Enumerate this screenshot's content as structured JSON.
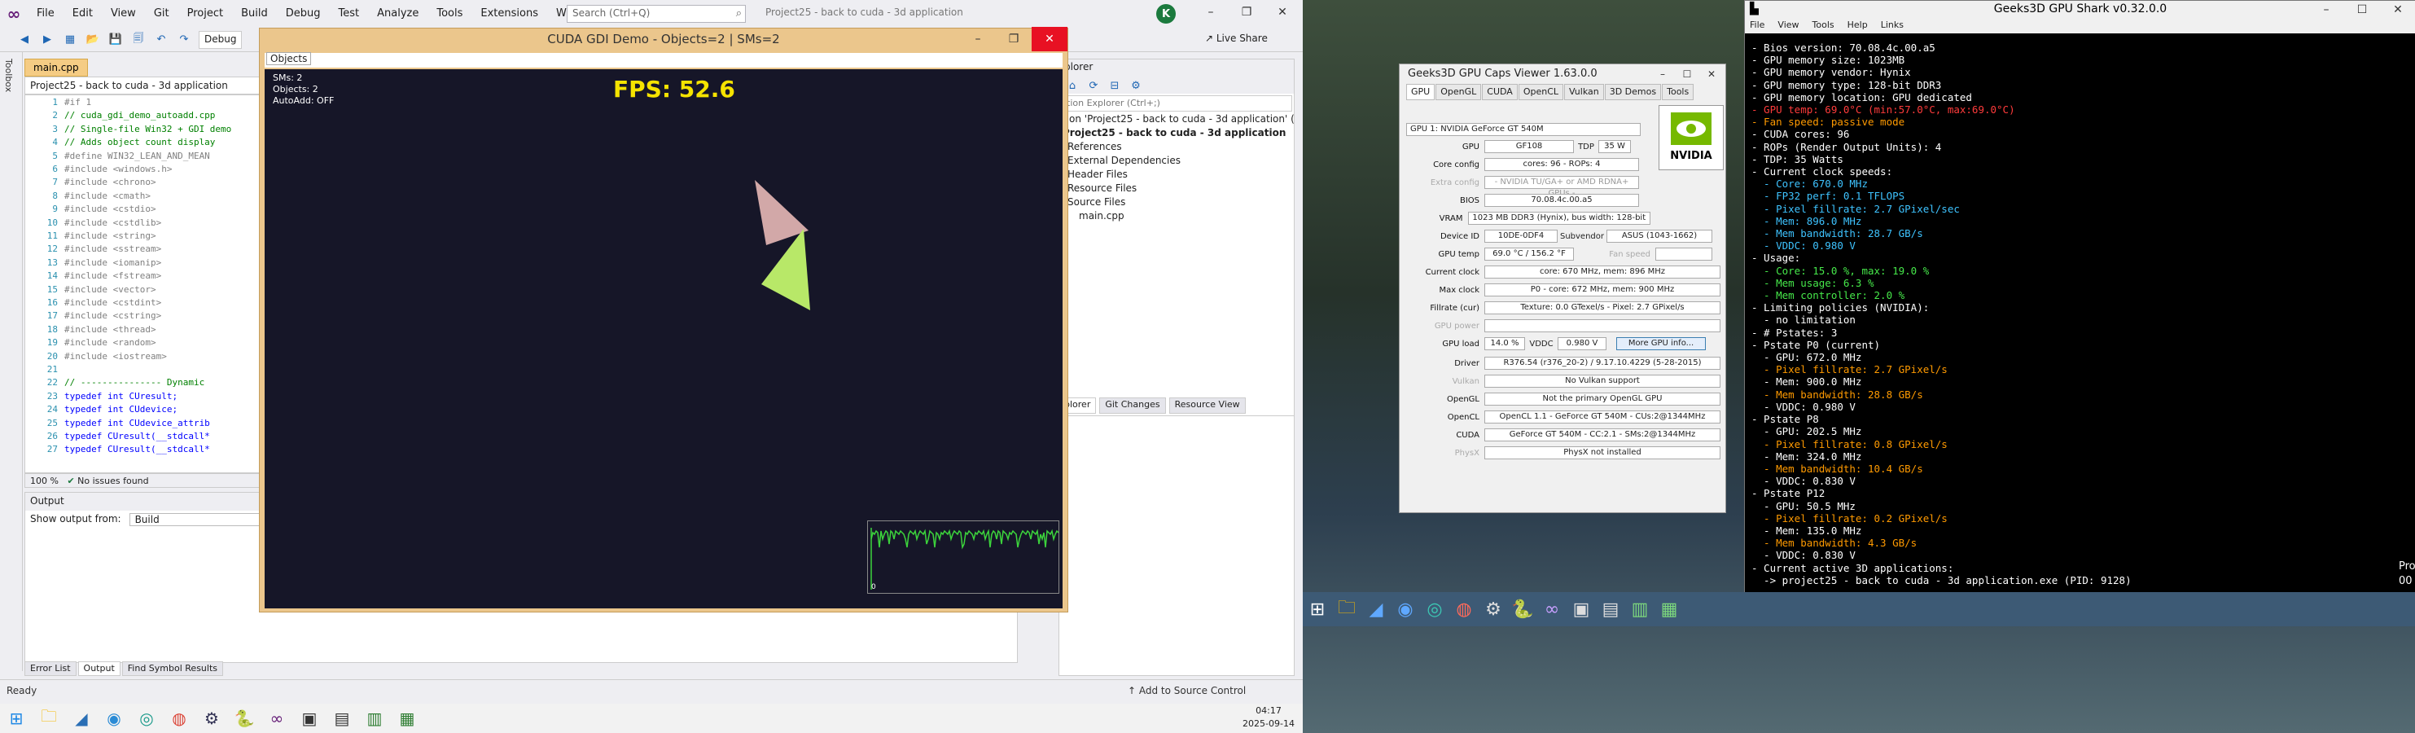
{
  "vs": {
    "menu": [
      "File",
      "Edit",
      "View",
      "Git",
      "Project",
      "Build",
      "Debug",
      "Test",
      "Analyze",
      "Tools",
      "Extensions",
      "Window",
      "Help"
    ],
    "search_placeholder": "Search (Ctrl+Q)",
    "project_title": "Project25 - back to cuda - 3d application",
    "avatar_letter": "K",
    "live_share": "Live Share",
    "debug_combo": "Debug",
    "toolbox_label": "Toolbox",
    "doc_tab": "main.cpp",
    "nav_project": "Project25 - back to cuda - 3d application",
    "code_lines": [
      {
        "n": "1",
        "t": "#if 1",
        "c": "pre"
      },
      {
        "n": "2",
        "t": "// cuda_gdi_demo_autoadd.cpp",
        "c": "comment"
      },
      {
        "n": "3",
        "t": "// Single-file Win32 + GDI demo",
        "c": "comment"
      },
      {
        "n": "4",
        "t": "// Adds object count display",
        "c": "comment"
      },
      {
        "n": "5",
        "t": "#define WIN32_LEAN_AND_MEAN",
        "c": "pre"
      },
      {
        "n": "6",
        "t": "#include <windows.h>",
        "c": "pre"
      },
      {
        "n": "7",
        "t": "#include <chrono>",
        "c": "pre"
      },
      {
        "n": "8",
        "t": "#include <cmath>",
        "c": "pre"
      },
      {
        "n": "9",
        "t": "#include <cstdio>",
        "c": "pre"
      },
      {
        "n": "10",
        "t": "#include <cstdlib>",
        "c": "pre"
      },
      {
        "n": "11",
        "t": "#include <string>",
        "c": "pre"
      },
      {
        "n": "12",
        "t": "#include <sstream>",
        "c": "pre"
      },
      {
        "n": "13",
        "t": "#include <iomanip>",
        "c": "pre"
      },
      {
        "n": "14",
        "t": "#include <fstream>",
        "c": "pre"
      },
      {
        "n": "15",
        "t": "#include <vector>",
        "c": "pre"
      },
      {
        "n": "16",
        "t": "#include <cstdint>",
        "c": "pre"
      },
      {
        "n": "17",
        "t": "#include <cstring>",
        "c": "pre"
      },
      {
        "n": "18",
        "t": "#include <thread>",
        "c": "pre"
      },
      {
        "n": "19",
        "t": "#include <random>",
        "c": "pre"
      },
      {
        "n": "20",
        "t": "#include <iostream>",
        "c": "pre"
      },
      {
        "n": "21",
        "t": "",
        "c": "pre"
      },
      {
        "n": "22",
        "t": "// --------------- Dynamic",
        "c": "comment"
      },
      {
        "n": "23",
        "t": "typedef int CUresult;",
        "c": "typ"
      },
      {
        "n": "24",
        "t": "typedef int CUdevice;",
        "c": "typ"
      },
      {
        "n": "25",
        "t": "typedef int CUdevice_attrib",
        "c": "typ"
      },
      {
        "n": "26",
        "t": "typedef CUresult(__stdcall*",
        "c": "typ"
      },
      {
        "n": "27",
        "t": "typedef CUresult(__stdcall*",
        "c": "typ"
      }
    ],
    "zoom": "100 %",
    "issues": "No issues found",
    "output_title": "Output",
    "output_from_label": "Show output from:",
    "output_from_value": "Build",
    "bottom_tabs": [
      "Error List",
      "Output",
      "Find Symbol Results"
    ],
    "status_ready": "Ready",
    "add_source_control": "Add to Source Control",
    "solution": {
      "title": "plorer",
      "search": "tion Explorer (Ctrl+;)",
      "items": [
        "tion 'Project25 - back to cuda - 3d application' (1 of 1 p",
        "Project25 - back to cuda - 3d application",
        "References",
        "External Dependencies",
        "Header Files",
        "Resource Files",
        "Source Files",
        "main.cpp"
      ],
      "bottom_tabs": [
        "plorer",
        "Git Changes",
        "Resource View"
      ]
    }
  },
  "cuda": {
    "title": "CUDA GDI Demo - Objects=2 | SMs=2",
    "menu": "Objects",
    "overlay": [
      "SMs: 2",
      "Objects: 2",
      "AutoAdd: OFF"
    ],
    "fps": "FPS: 52.6",
    "graph_zero": "0",
    "graph_color": "#3cd43c"
  },
  "left_taskbar": {
    "time": "04:17",
    "date": "2025-09-14"
  },
  "gcv": {
    "title": "Geeks3D GPU Caps Viewer 1.63.0.0",
    "tabs": [
      "GPU",
      "OpenGL",
      "CUDA",
      "OpenCL",
      "Vulkan",
      "3D Demos",
      "Tools"
    ],
    "gpu_select": "GPU 1: NVIDIA GeForce GT 540M",
    "gpu": "GF108",
    "tdp_label": "TDP",
    "tdp": "35 W",
    "core_config": "cores: 96 - ROPs: 4",
    "extra_config": "- NVIDIA TU/GA+ or AMD RDNA+ GPUs -",
    "bios": "70.08.4c.00.a5",
    "vram": "1023 MB DDR3 (Hynix), bus width: 128-bit",
    "device_id": "10DE-0DF4",
    "subvendor_label": "Subvendor",
    "subvendor": "ASUS (1043-1662)",
    "gpu_temp": "69.0 °C / 156.2 °F",
    "fan_speed_label": "Fan speed",
    "current_clock": "core: 670 MHz, mem: 896 MHz",
    "max_clock": "P0 - core: 672 MHz, mem: 900 MHz",
    "fillrate": "Texture: 0.0 GTexel/s - Pixel: 2.7 GPixel/s",
    "gpu_load": "14.0 %",
    "vddc_label": "VDDC",
    "vddc": "0.980 V",
    "more_info": "More GPU info...",
    "driver": "R376.54 (r376_20-2) / 9.17.10.4229 (5-28-2015)",
    "vulkan": "No Vulkan support",
    "opengl": "Not the primary OpenGL GPU",
    "opencl": "OpenCL 1.1 - GeForce GT 540M - CUs:2@1344MHz",
    "cuda": "GeForce GT 540M - CC:2.1 - SMs:2@1344MHz",
    "physx": "PhysX not installed",
    "labels": {
      "gpu": "GPU",
      "core_config": "Core config",
      "extra_config": "Extra config",
      "bios": "BIOS",
      "vram": "VRAM",
      "device_id": "Device ID",
      "gpu_temp": "GPU temp",
      "current_clock": "Current clock",
      "max_clock": "Max clock",
      "fillrate": "Fillrate (cur)",
      "gpu_power": "GPU power",
      "gpu_load": "GPU load",
      "driver": "Driver",
      "vulkan": "Vulkan",
      "opengl": "OpenGL",
      "opencl": "OpenCL",
      "cuda": "CUDA",
      "physx": "PhysX"
    },
    "logo_text": "NVIDIA"
  },
  "shark": {
    "title": "Geeks3D GPU Shark v0.32.0.0",
    "menu": [
      "File",
      "View",
      "Tools",
      "Help",
      "Links"
    ],
    "lines": [
      {
        "t": "- Bios version: 70.08.4c.00.a5",
        "c": "#ffffff"
      },
      {
        "t": "- GPU memory size: 1023MB",
        "c": "#ffffff"
      },
      {
        "t": "- GPU memory vendor: Hynix",
        "c": "#ffffff"
      },
      {
        "t": "- GPU memory type: 128-bit DDR3",
        "c": "#ffffff"
      },
      {
        "t": "- GPU memory location: GPU dedicated",
        "c": "#ffffff"
      },
      {
        "t": "- GPU temp: 69.0°C (min:57.0°C, max:69.0°C)",
        "c": "#ff3b3b"
      },
      {
        "t": "- Fan speed: passive mode",
        "c": "#ff9a00"
      },
      {
        "t": "- CUDA cores: 96",
        "c": "#ffffff"
      },
      {
        "t": "- ROPs (Render Output Units): 4",
        "c": "#ffffff"
      },
      {
        "t": "- TDP: 35 Watts",
        "c": "#ffffff"
      },
      {
        "t": "- Current clock speeds:",
        "c": "#ffffff"
      },
      {
        "t": "  - Core: 670.0 MHz",
        "c": "#3ec3ff"
      },
      {
        "t": "  - FP32 perf: 0.1 TFLOPS",
        "c": "#3ec3ff"
      },
      {
        "t": "  - Pixel fillrate: 2.7 GPixel/sec",
        "c": "#3ec3ff"
      },
      {
        "t": "  - Mem: 896.0 MHz",
        "c": "#3ec3ff"
      },
      {
        "t": "  - Mem bandwidth: 28.7 GB/s",
        "c": "#3ec3ff"
      },
      {
        "t": "  - VDDC: 0.980 V",
        "c": "#3ec3ff"
      },
      {
        "t": "- Usage:",
        "c": "#ffffff"
      },
      {
        "t": "  - Core: 15.0 %, max: 19.0 %",
        "c": "#46e84a"
      },
      {
        "t": "  - Mem usage: 6.3 %",
        "c": "#46e84a"
      },
      {
        "t": "  - Mem controller: 2.0 %",
        "c": "#46e84a"
      },
      {
        "t": "- Limiting policies (NVIDIA):",
        "c": "#ffffff"
      },
      {
        "t": "  - no limitation",
        "c": "#ffffff"
      },
      {
        "t": "- # Pstates: 3",
        "c": "#ffffff"
      },
      {
        "t": "- Pstate P0 (current)",
        "c": "#ffffff"
      },
      {
        "t": "  - GPU: 672.0 MHz",
        "c": "#ffffff"
      },
      {
        "t": "  - Pixel fillrate: 2.7 GPixel/s",
        "c": "#ff9a00"
      },
      {
        "t": "  - Mem: 900.0 MHz",
        "c": "#ffffff"
      },
      {
        "t": "  - Mem bandwidth: 28.8 GB/s",
        "c": "#ff9a00"
      },
      {
        "t": "  - VDDC: 0.980 V",
        "c": "#ffffff"
      },
      {
        "t": "- Pstate P8",
        "c": "#ffffff"
      },
      {
        "t": "  - GPU: 202.5 MHz",
        "c": "#ffffff"
      },
      {
        "t": "  - Pixel fillrate: 0.8 GPixel/s",
        "c": "#ff9a00"
      },
      {
        "t": "  - Mem: 324.0 MHz",
        "c": "#ffffff"
      },
      {
        "t": "  - Mem bandwidth: 10.4 GB/s",
        "c": "#ff9a00"
      },
      {
        "t": "  - VDDC: 0.830 V",
        "c": "#ffffff"
      },
      {
        "t": "- Pstate P12",
        "c": "#ffffff"
      },
      {
        "t": "  - GPU: 50.5 MHz",
        "c": "#ffffff"
      },
      {
        "t": "  - Pixel fillrate: 0.2 GPixel/s",
        "c": "#ff9a00"
      },
      {
        "t": "  - Mem: 135.0 MHz",
        "c": "#ffffff"
      },
      {
        "t": "  - Mem bandwidth: 4.3 GB/s",
        "c": "#ff9a00"
      },
      {
        "t": "  - VDDC: 0.830 V",
        "c": "#ffffff"
      },
      {
        "t": "- Current active 3D applications:",
        "c": "#ffffff"
      },
      {
        "t": "  -> project25 - back to cuda - 3d application.exe (PID: 9128)",
        "c": "#ffffff"
      }
    ],
    "edge_text_1": "Pro",
    "edge_text_2": "00"
  }
}
